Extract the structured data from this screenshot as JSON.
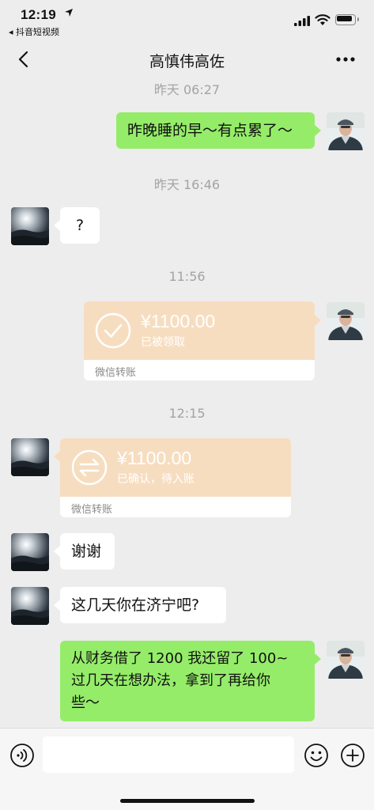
{
  "status_bar": {
    "time": "12:19",
    "back_app": "◂ 抖音短视频"
  },
  "nav": {
    "title": "高慎伟高佐"
  },
  "messages": [
    {
      "type": "timestamp",
      "text": "昨天 06:27"
    },
    {
      "type": "text",
      "side": "right",
      "text": "昨晚睡的早～有点累了～"
    },
    {
      "type": "timestamp",
      "text": "昨天 16:46"
    },
    {
      "type": "text",
      "side": "left",
      "text": "?"
    },
    {
      "type": "timestamp",
      "text": "11:56"
    },
    {
      "type": "transfer",
      "side": "right",
      "amount": "¥1100.00",
      "status": "已被领取",
      "label": "微信转账"
    },
    {
      "type": "timestamp",
      "text": "12:15"
    },
    {
      "type": "transfer",
      "side": "left",
      "amount": "¥1100.00",
      "status": "已确认，待入账",
      "label": "微信转账"
    },
    {
      "type": "text",
      "side": "left",
      "text": "谢谢"
    },
    {
      "type": "text",
      "side": "left",
      "text": "这几天你在济宁吧?"
    },
    {
      "type": "text",
      "side": "right",
      "lines": [
        "从财务借了 1200 我还留了 100~",
        "过几天在想办法，拿到了再给你",
        "些～"
      ]
    }
  ],
  "input": {
    "value": "",
    "placeholder": ""
  },
  "colors": {
    "background": "#ededed",
    "bubble_green": "#95ec69",
    "bubble_white": "#ffffff",
    "transfer_orange": "#f7ddc0",
    "timestamp_gray": "#a3a3a3"
  },
  "icons": [
    "location-arrow-icon",
    "signal-icon",
    "wifi-icon",
    "battery-icon",
    "back-chevron-icon",
    "more-dots-icon",
    "voice-icon",
    "emoji-icon",
    "plus-icon",
    "check-circle-icon",
    "exchange-arrows-icon"
  ]
}
